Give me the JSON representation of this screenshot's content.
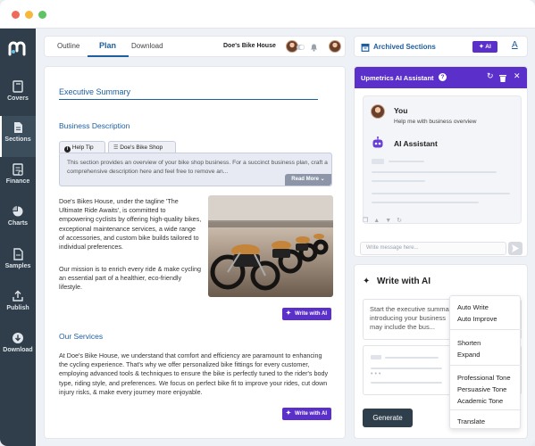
{
  "window": {
    "dots": [
      "#f06a5b",
      "#f5b83a",
      "#5fc264"
    ]
  },
  "colors": {
    "accent": "#1e5fa0",
    "brand_purple": "#5b2fc9",
    "sidebar": "#2f3e4a"
  },
  "sidebar": {
    "items": [
      {
        "label": "Covers",
        "icon": "book-icon"
      },
      {
        "label": "Sections",
        "icon": "document-icon",
        "active": true
      },
      {
        "label": "Finance",
        "icon": "finance-icon"
      },
      {
        "label": "Charts",
        "icon": "pie-chart-icon"
      },
      {
        "label": "Samples",
        "icon": "file-icon"
      },
      {
        "label": "Publish",
        "icon": "share-icon"
      },
      {
        "label": "Download",
        "icon": "download-icon"
      }
    ]
  },
  "topbar": {
    "tabs": [
      "Outline",
      "Plan",
      "Download"
    ],
    "active_tab": "Plan",
    "company": "Doe's Bike House"
  },
  "main": {
    "heading": "Executive Summary",
    "business_description_heading": "Business Description",
    "help_tab": "Help Tip",
    "shop_tab": "Doe's Bike Shop",
    "tip_text": "This section provides an overview of your bike shop business. For a succinct business plan, craft a comprehensive description here and feel free to remove an...",
    "read_more": "Read More",
    "para1": "Doe's Bikes House, under the tagline 'The Ultimate Ride Awaits', is committed to empowering cyclists by offering high-quality bikes, exceptional maintenance services, a wide range of accessories, and custom bike builds tailored to individual preferences.",
    "para2": "Our mission is to enrich every ride & make cycling an essential part of a healthier, eco-friendly lifestyle.",
    "write_with_ai": "Write with AI",
    "services_heading": "Our Services",
    "services_text": "At Doe's Bike House, we understand that comfort and efficiency are paramount to enhancing the cycling experience. That's why we offer personalized bike fittings for every customer, employing advanced tools & techniques to ensure the bike is perfectly tuned to the rider's body type, riding style, and preferences. We focus on perfect bike fit to improve your rides, cut down injury risks, & make every journey more enjoyable.",
    "write_with_ai_2": "Write with AI"
  },
  "right_top": {
    "archived": "Archived Sections",
    "ai_label": "AI",
    "text_icon_label": "A"
  },
  "assistant": {
    "title": "Upmetrics AI Assistant",
    "you_label": "You",
    "you_message": "Help me with business overview",
    "ai_label": "AI Assistant",
    "input_placeholder": "Write message here..."
  },
  "write_ai": {
    "title": "Write with AI",
    "prompt_text": "Start the executive summary introducing your business may include the bus...",
    "generate": "Generate",
    "menu": {
      "group1": [
        "Auto Write",
        "Auto Improve"
      ],
      "group2": [
        "Shorten",
        "Expand"
      ],
      "group3": [
        "Professional Tone",
        "Persuasive Tone",
        "Academic Tone"
      ],
      "group4": [
        "Translate"
      ]
    }
  }
}
